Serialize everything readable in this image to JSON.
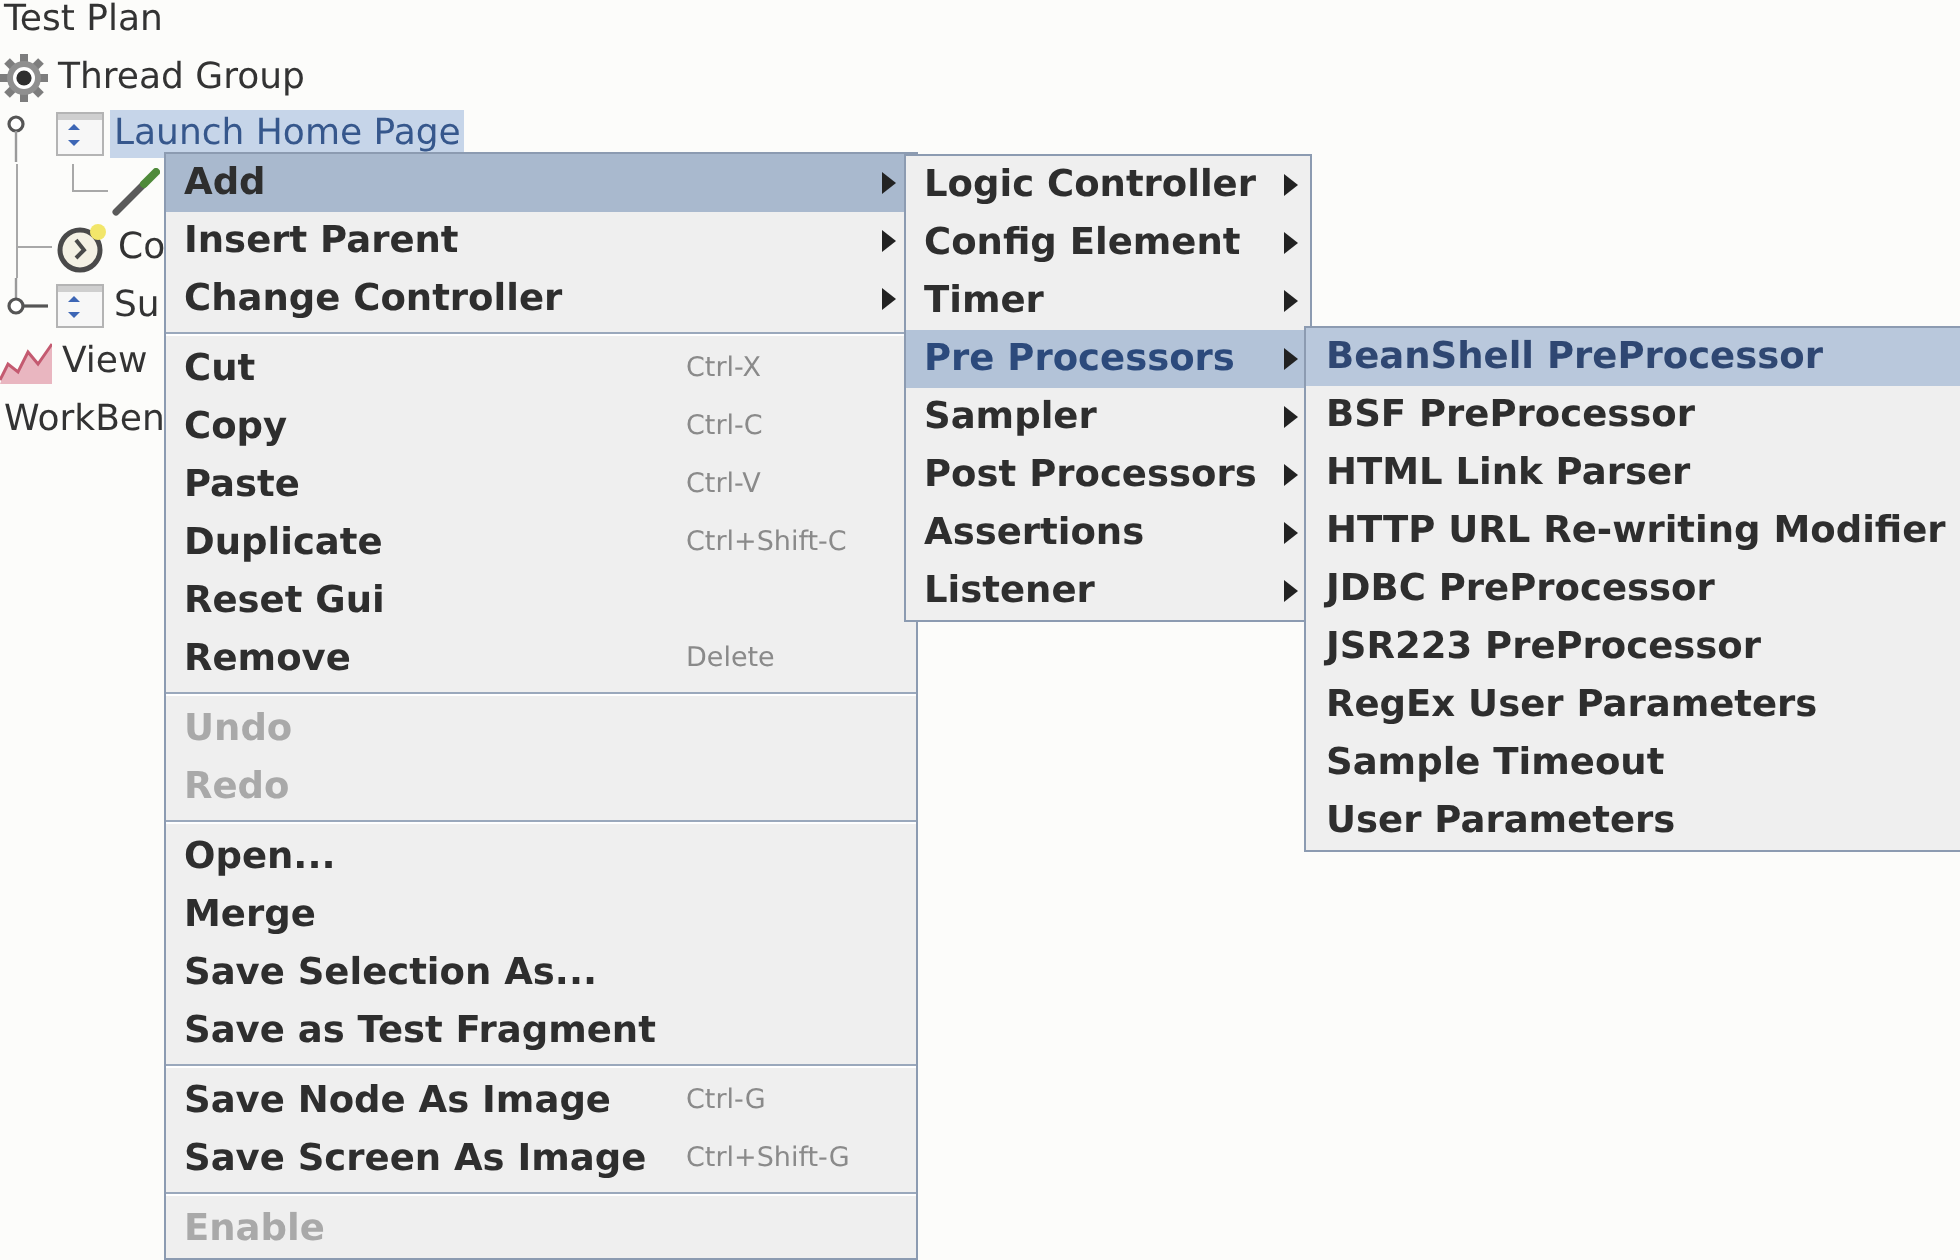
{
  "tree": [
    {
      "label": "Test Plan",
      "selected": false,
      "children": [
        {
          "label": "Thread Group",
          "kind": "thread-group",
          "selected": false,
          "children": [
            {
              "label": "Launch Home Page",
              "kind": "controller",
              "selected": true,
              "expanded": true,
              "children": [
                {
                  "kind": "preprocessor",
                  "selected": false
                }
              ]
            },
            {
              "label": "Co",
              "kind": "timer",
              "selected": false
            },
            {
              "label": "Su",
              "kind": "controller",
              "selected": false,
              "expanded": false
            }
          ]
        },
        {
          "label": "View",
          "kind": "listener",
          "selected": false
        }
      ]
    },
    {
      "label": "WorkBen",
      "selected": false
    }
  ],
  "context_menu": {
    "items": [
      {
        "kind": "item",
        "label": "Add",
        "submenu": true,
        "selected": true,
        "disabled": false
      },
      {
        "kind": "item",
        "label": "Insert Parent",
        "submenu": true,
        "selected": false,
        "disabled": false
      },
      {
        "kind": "item",
        "label": "Change Controller",
        "submenu": true,
        "selected": false,
        "disabled": false
      },
      {
        "kind": "separator"
      },
      {
        "kind": "item",
        "label": "Cut",
        "shortcut": "Ctrl-X",
        "submenu": false,
        "selected": false,
        "disabled": false
      },
      {
        "kind": "item",
        "label": "Copy",
        "shortcut": "Ctrl-C",
        "submenu": false,
        "selected": false,
        "disabled": false
      },
      {
        "kind": "item",
        "label": "Paste",
        "shortcut": "Ctrl-V",
        "submenu": false,
        "selected": false,
        "disabled": false
      },
      {
        "kind": "item",
        "label": "Duplicate",
        "shortcut": "Ctrl+Shift-C",
        "submenu": false,
        "selected": false,
        "disabled": false
      },
      {
        "kind": "item",
        "label": "Reset Gui",
        "submenu": false,
        "selected": false,
        "disabled": false
      },
      {
        "kind": "item",
        "label": "Remove",
        "shortcut": "Delete",
        "submenu": false,
        "selected": false,
        "disabled": false
      },
      {
        "kind": "separator"
      },
      {
        "kind": "item",
        "label": "Undo",
        "submenu": false,
        "selected": false,
        "disabled": true
      },
      {
        "kind": "item",
        "label": "Redo",
        "submenu": false,
        "selected": false,
        "disabled": true
      },
      {
        "kind": "separator"
      },
      {
        "kind": "item",
        "label": "Open...",
        "submenu": false,
        "selected": false,
        "disabled": false
      },
      {
        "kind": "item",
        "label": "Merge",
        "submenu": false,
        "selected": false,
        "disabled": false
      },
      {
        "kind": "item",
        "label": "Save Selection As...",
        "submenu": false,
        "selected": false,
        "disabled": false
      },
      {
        "kind": "item",
        "label": "Save as Test Fragment",
        "submenu": false,
        "selected": false,
        "disabled": false
      },
      {
        "kind": "separator"
      },
      {
        "kind": "item",
        "label": "Save Node As Image",
        "shortcut": "Ctrl-G",
        "submenu": false,
        "selected": false,
        "disabled": false
      },
      {
        "kind": "item",
        "label": "Save Screen As Image",
        "shortcut": "Ctrl+Shift-G",
        "submenu": false,
        "selected": false,
        "disabled": false
      },
      {
        "kind": "separator"
      },
      {
        "kind": "item",
        "label": "Enable",
        "submenu": false,
        "selected": false,
        "disabled": true
      }
    ]
  },
  "add_submenu": {
    "items": [
      {
        "label": "Logic Controller",
        "selected": false
      },
      {
        "label": "Config Element",
        "selected": false
      },
      {
        "label": "Timer",
        "selected": false
      },
      {
        "label": "Pre Processors",
        "selected": true
      },
      {
        "label": "Sampler",
        "selected": false
      },
      {
        "label": "Post Processors",
        "selected": false
      },
      {
        "label": "Assertions",
        "selected": false
      },
      {
        "label": "Listener",
        "selected": false
      }
    ]
  },
  "pre_processors_submenu": {
    "items": [
      {
        "label": "BeanShell PreProcessor",
        "selected": true
      },
      {
        "label": "BSF PreProcessor",
        "selected": false
      },
      {
        "label": "HTML Link Parser",
        "selected": false
      },
      {
        "label": "HTTP URL Re-writing Modifier",
        "selected": false
      },
      {
        "label": "JDBC PreProcessor",
        "selected": false
      },
      {
        "label": "JSR223 PreProcessor",
        "selected": false
      },
      {
        "label": "RegEx User Parameters",
        "selected": false
      },
      {
        "label": "Sample Timeout",
        "selected": false
      },
      {
        "label": "User Parameters",
        "selected": false
      }
    ]
  }
}
